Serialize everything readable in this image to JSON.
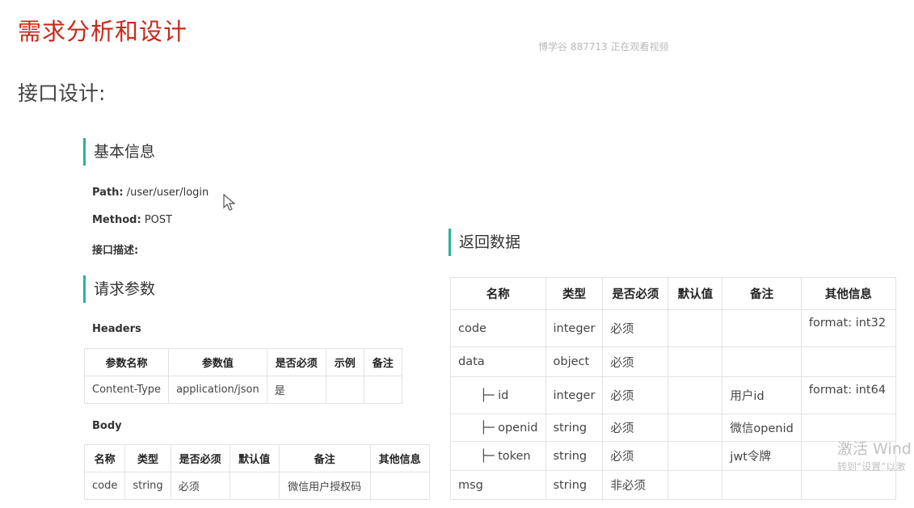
{
  "page_title": "需求分析和设计",
  "watermark": "博学谷 887713 正在观看视频",
  "subtitle": "接口设计:",
  "basic_info": {
    "heading": "基本信息",
    "path_label": "Path:",
    "path_value": "/user/user/login",
    "method_label": "Method:",
    "method_value": "POST",
    "desc_label": "接口描述:"
  },
  "request": {
    "heading": "请求参数",
    "headers_label": "Headers",
    "headers_columns": [
      "参数名称",
      "参数值",
      "是否必须",
      "示例",
      "备注"
    ],
    "headers_rows": [
      [
        "Content-Type",
        "application/json",
        "是",
        "",
        ""
      ]
    ],
    "body_label": "Body",
    "body_columns": [
      "名称",
      "类型",
      "是否必须",
      "默认值",
      "备注",
      "其他信息"
    ],
    "body_rows": [
      [
        "code",
        "string",
        "必须",
        "",
        "微信用户授权码",
        ""
      ]
    ]
  },
  "response": {
    "heading": "返回数据",
    "columns": [
      "名称",
      "类型",
      "是否必须",
      "默认值",
      "备注",
      "其他信息"
    ],
    "rows": [
      [
        "code",
        "integer",
        "必须",
        "",
        "",
        "format: int32"
      ],
      [
        "data",
        "object",
        "必须",
        "",
        "",
        ""
      ],
      [
        "├─ id",
        "integer",
        "必须",
        "",
        "用户id",
        "format: int64"
      ],
      [
        "├─ openid",
        "string",
        "必须",
        "",
        "微信openid",
        ""
      ],
      [
        "├─ token",
        "string",
        "必须",
        "",
        "jwt令牌",
        ""
      ],
      [
        "msg",
        "string",
        "非必须",
        "",
        "",
        ""
      ]
    ]
  },
  "os_overlay": {
    "line1": "激活 Wind",
    "line2": "转到“设置”以激"
  }
}
